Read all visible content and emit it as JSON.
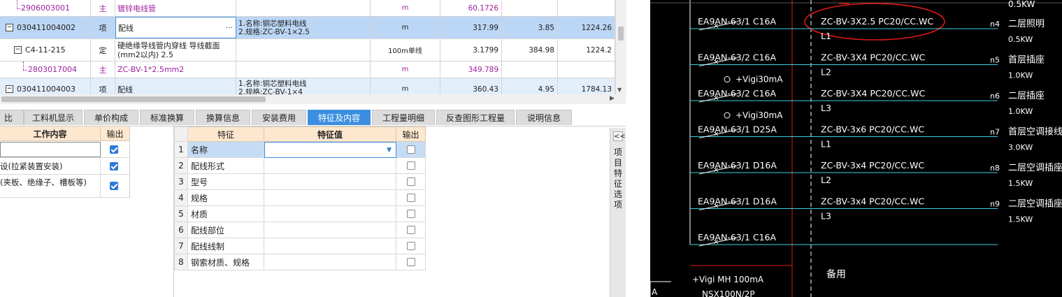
{
  "grid": {
    "rows": [
      {
        "code": "2906003001",
        "type": "主",
        "name": "镀锌电线管",
        "feature": "",
        "unit": "m",
        "qty": "60.1726",
        "price": "",
        "total": ""
      },
      {
        "code": "030411004002",
        "type": "项",
        "name": "配线",
        "feature1": "1.名称:铜芯塑料电线",
        "feature2": "2.规格:ZC-BV-1×2.5",
        "unit": "m",
        "qty": "317.99",
        "price": "3.85",
        "total": "1224.26",
        "name_btn": "···"
      },
      {
        "code": "C4-11-215",
        "type": "定",
        "name1": "硬绝缘导线管内穿线 导线截面",
        "name2": "(mm2以内) 2.5",
        "feature": "",
        "unit": "100m单线",
        "qty": "3.1799",
        "price": "384.98",
        "total": "1224.2"
      },
      {
        "code": "2803017004",
        "type": "主",
        "name": "ZC-BV-1*2.5mm2",
        "feature": "",
        "unit": "m",
        "qty": "349.789",
        "price": "",
        "total": ""
      },
      {
        "code": "030411004003",
        "type": "项",
        "name": "配线",
        "feature1": "1.名称:铜芯塑料电线",
        "feature2": "2.规格:ZC-BV-1×4",
        "unit": "m",
        "qty": "360.43",
        "price": "4.95",
        "total": "1784.13"
      }
    ]
  },
  "tabs": [
    "比",
    "工料机显示",
    "单价构成",
    "标准换算",
    "换算信息",
    "安装费用",
    "特征及内容",
    "工程量明细",
    "反查图形工程量",
    "说明信息"
  ],
  "active_tab": "特征及内容",
  "work_panel": {
    "header_content": "工作内容",
    "header_output": "输出",
    "rows": [
      {
        "text": "",
        "checked": true
      },
      {
        "text": "设(拉紧装置安装)",
        "checked": true
      },
      {
        "text": "(夹板、绝缘子、槽板等)",
        "checked": true
      }
    ]
  },
  "feature_table": {
    "header_feature": "特征",
    "header_value": "特征值",
    "header_output": "输出",
    "rows": [
      {
        "num": "1",
        "name": "名称",
        "value": "",
        "checked": false
      },
      {
        "num": "2",
        "name": "配线形式",
        "value": "",
        "checked": false
      },
      {
        "num": "3",
        "name": "型号",
        "value": "",
        "checked": false
      },
      {
        "num": "4",
        "name": "规格",
        "value": "",
        "checked": false
      },
      {
        "num": "5",
        "name": "材质",
        "value": "",
        "checked": false
      },
      {
        "num": "6",
        "name": "配线部位",
        "value": "",
        "checked": false
      },
      {
        "num": "7",
        "name": "配线线制",
        "value": "",
        "checked": false
      },
      {
        "num": "8",
        "name": "钢索材质、规格",
        "value": "",
        "checked": false
      }
    ]
  },
  "side_tab": {
    "collapse": "<<",
    "label": "项目特征选项"
  },
  "cad": {
    "top_power": "0.5KW",
    "circuits": [
      {
        "breaker": "EA9AN-63/1 C16A",
        "cable": "ZC-BV-3X2.5 PC20/CC.WC",
        "phase": "L1",
        "id": "n4",
        "label": "二层照明",
        "power": "0.5KW",
        "vigi": ""
      },
      {
        "breaker": "EA9AN-63/2 C16A",
        "cable": "ZC-BV-3X4 PC20/CC.WC",
        "phase": "L2",
        "id": "n5",
        "label": "首层插座",
        "power": "1.0KW",
        "vigi": "+Vigi30mA"
      },
      {
        "breaker": "EA9AN-63/2 C16A",
        "cable": "ZC-BV-3X4 PC20/CC.WC",
        "phase": "L3",
        "id": "n6",
        "label": "二层插座",
        "power": "1.0KW",
        "vigi": "+Vigi30mA"
      },
      {
        "breaker": "EA9AN-63/1 D25A",
        "cable": "ZC-BV-3x6 PC20/CC.WC",
        "phase": "L1",
        "id": "n7",
        "label": "首层空调接线盒",
        "power": "3.0KW",
        "vigi": ""
      },
      {
        "breaker": "EA9AN-63/1 D16A",
        "cable": "ZC-BV-3x4 PC20/CC.WC",
        "phase": "L2",
        "id": "n8",
        "label": "二层空调插座",
        "power": "1.5KW",
        "vigi": ""
      },
      {
        "breaker": "EA9AN-63/1 D16A",
        "cable": "ZC-BV-3x4 PC20/CC.WC",
        "phase": "L3",
        "id": "n9",
        "label": "二层空调插座",
        "power": "1.5KW",
        "vigi": ""
      },
      {
        "breaker": "EA9AN-63/1 C16A",
        "cable": "",
        "phase": "",
        "id": "",
        "label": "",
        "power": "",
        "vigi": "",
        "spare": "备用"
      }
    ],
    "main_vigi": "+Vigi MH 100mA",
    "main_breaker": "NSX100N/2P",
    "corner": "A"
  },
  "colors": {
    "accent": "#3c8fe0",
    "row_selected": "#bcd6f5",
    "purple": "#a0219f",
    "header_bg": "#fde7cf",
    "cad_bg": "#000000",
    "cad_line": "#3fd0e0",
    "cad_red": "#e01818"
  }
}
